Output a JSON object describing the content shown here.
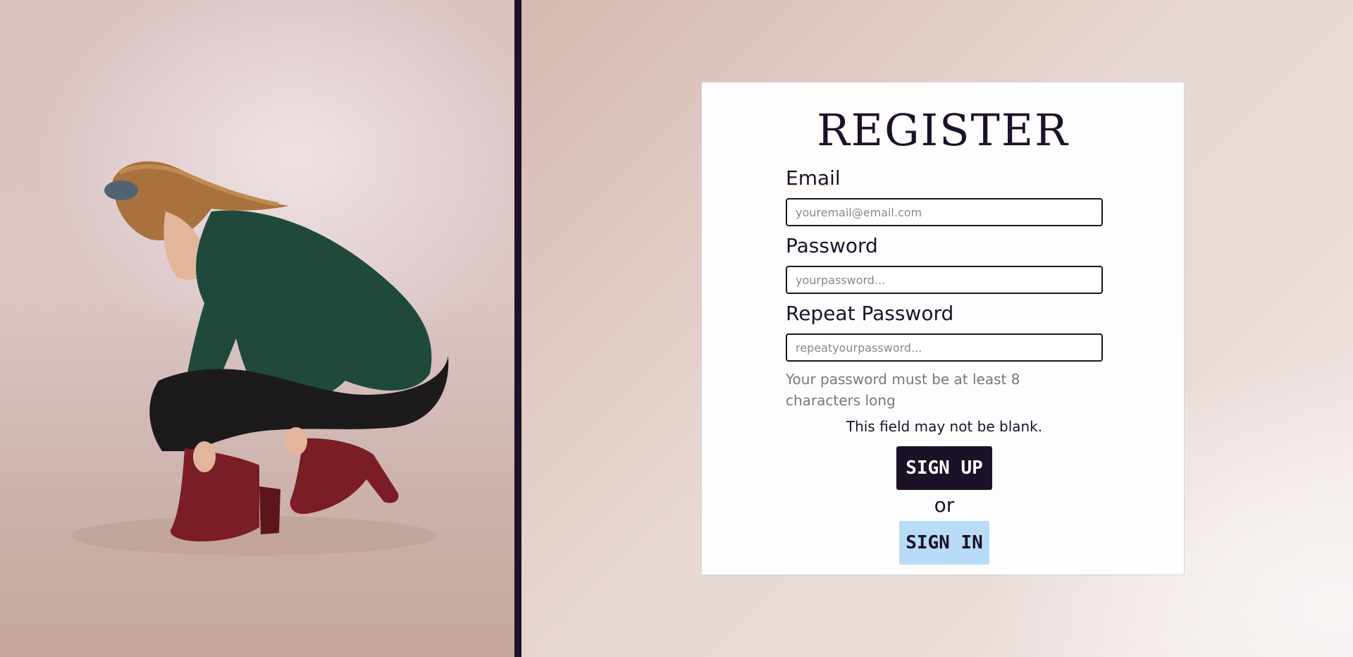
{
  "form": {
    "title": "REGISTER",
    "email": {
      "label": "Email",
      "placeholder": "youremail@email.com"
    },
    "password": {
      "label": "Password",
      "placeholder": "yourpassword..."
    },
    "repeat_password": {
      "label": "Repeat Password",
      "placeholder": "repeatyourpassword..."
    },
    "password_hint": "Your password must be at least 8 characters long",
    "error_message": "This field may not be blank.",
    "signup_label": "SIGN UP",
    "or_text": "or",
    "signin_label": "SIGN IN"
  },
  "colors": {
    "primary_dark": "#1c1228",
    "signin_button": "#b8dcf8",
    "card_background": "#ffffff"
  }
}
